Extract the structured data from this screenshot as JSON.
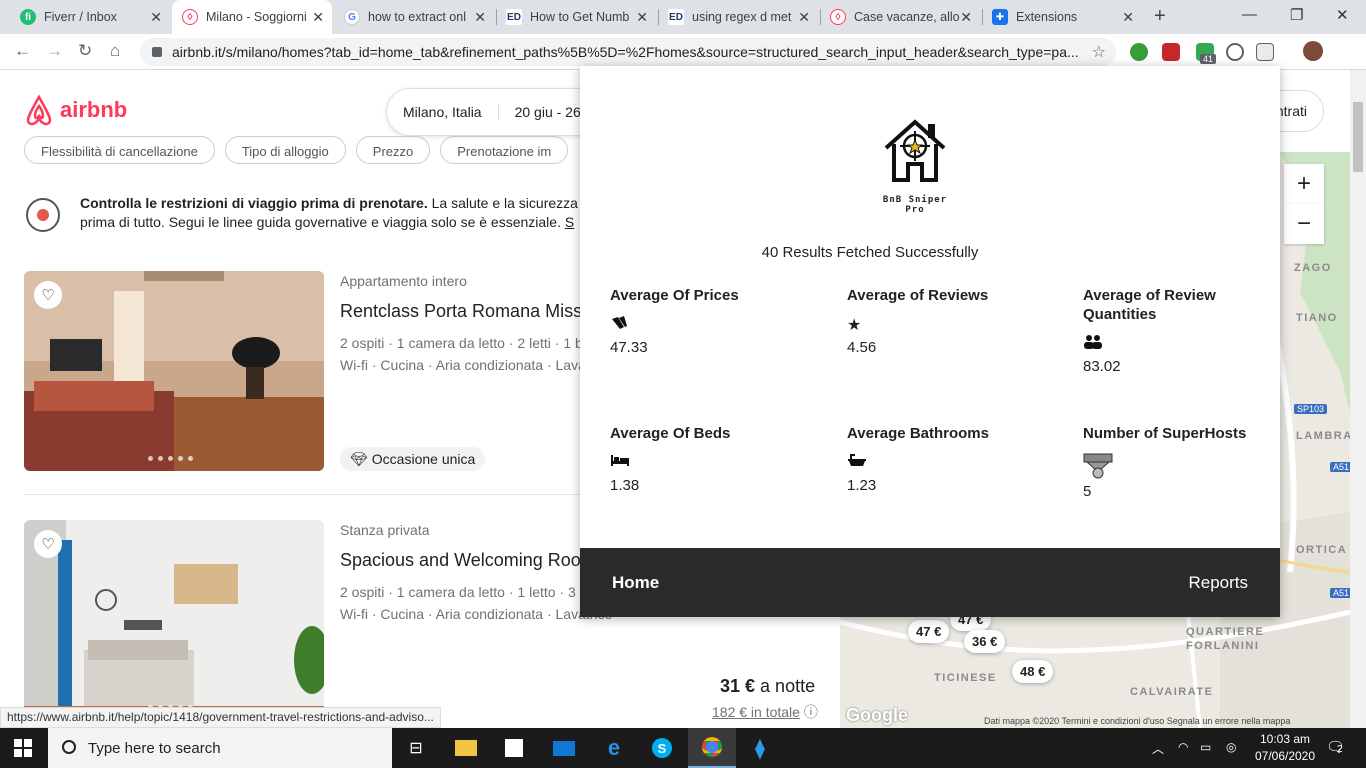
{
  "browser": {
    "tabs": [
      {
        "title": "Fiverr / Inbox",
        "icon": "fiverr-icon",
        "color": "#1dbf73"
      },
      {
        "title": "Milano - Soggiorni",
        "icon": "airbnb-icon",
        "color": "#ff385c"
      },
      {
        "title": "how to extract onl",
        "icon": "google-icon",
        "color": "#4285f4"
      },
      {
        "title": "How to Get Numb",
        "icon": "ed-icon",
        "color": "#1a3a6e"
      },
      {
        "title": "using regex d met",
        "icon": "ed-icon",
        "color": "#1a3a6e"
      },
      {
        "title": "Case vacanze, allo",
        "icon": "airbnb-icon",
        "color": "#ff385c"
      },
      {
        "title": "Extensions",
        "icon": "puzzle-icon",
        "color": "#1a73e8"
      }
    ],
    "active_tab": 1,
    "url": "airbnb.it/s/milano/homes?tab_id=home_tab&refinement_paths%5B%5D=%2Fhomes&source=structured_search_input_header&search_type=pa...",
    "extension_badge": "41",
    "status_url": "https://www.airbnb.it/help/topic/1418/government-travel-restrictions-and-adviso..."
  },
  "airbnb": {
    "logo_text": "airbnb",
    "search": {
      "location": "Milano, Italia",
      "dates": "20 giu - 26"
    },
    "login_label": "ntrati",
    "filters": [
      "Flessibilità di cancellazione",
      "Tipo di alloggio",
      "Prezzo",
      "Prenotazione im"
    ],
    "notice": {
      "bold": "Controlla le restrizioni di viaggio prima di prenotare.",
      "text": " La salute e la sicurezza",
      "line2": "prima di tutto. Segui le linee guida governative e viaggia solo se è essenziale. ",
      "link": "S"
    },
    "listings": [
      {
        "type": "Appartamento intero",
        "title": "Rentclass Porta Romana Missori",
        "details": "2 ospiti · 1 camera da letto · 2 letti · 1 b",
        "amenities": "Wi-fi · Cucina · Aria condizionata · Lava",
        "badge": "Occasione unica"
      },
      {
        "type": "Stanza privata",
        "title": "Spacious and Welcoming Room",
        "details": "2 ospiti · 1 camera da letto · 1 letto · 3 b",
        "amenities": "Wi-fi · Cucina · Aria condizionata · Lavatrice",
        "price_amount": "31 €",
        "price_unit": " a notte",
        "total": "182 € in totale"
      }
    ],
    "map": {
      "labels": [
        "ZAGO",
        "TIANO",
        "LAMBRA",
        "ORTICA",
        "TICINESE",
        "QUARTIERE",
        "FORLANINI",
        "CALVAIRATE"
      ],
      "pins": [
        "47 €",
        "47 €",
        "36 €",
        "48 €"
      ],
      "road_tags": [
        "SP103",
        "A51",
        "A51"
      ],
      "footer": "Dati mappa ©2020    Termini e condizioni d'uso    Segnala un errore nella mappa",
      "google": "Google"
    }
  },
  "popup": {
    "app_name": "BnB Sniper Pro",
    "fetched": "40 Results Fetched Successfully",
    "stats": [
      {
        "label": "Average Of Prices",
        "value": "47.33",
        "icon": "price-tag-icon"
      },
      {
        "label": "Average of Reviews",
        "value": "4.56",
        "icon": "star-icon"
      },
      {
        "label": "Average of Review Quantities",
        "value": "83.02",
        "icon": "users-icon"
      },
      {
        "label": "Average Of Beds",
        "value": "1.38",
        "icon": "bed-icon"
      },
      {
        "label": "Average Bathrooms",
        "value": "1.23",
        "icon": "bathtub-icon"
      },
      {
        "label": "Number of SuperHosts",
        "value": "5",
        "icon": "medal-icon"
      }
    ],
    "footer": {
      "home": "Home",
      "reports": "Reports"
    }
  },
  "taskbar": {
    "search_placeholder": "Type here to search",
    "time": "10:03 am",
    "date": "07/06/2020",
    "notifications": "2"
  }
}
